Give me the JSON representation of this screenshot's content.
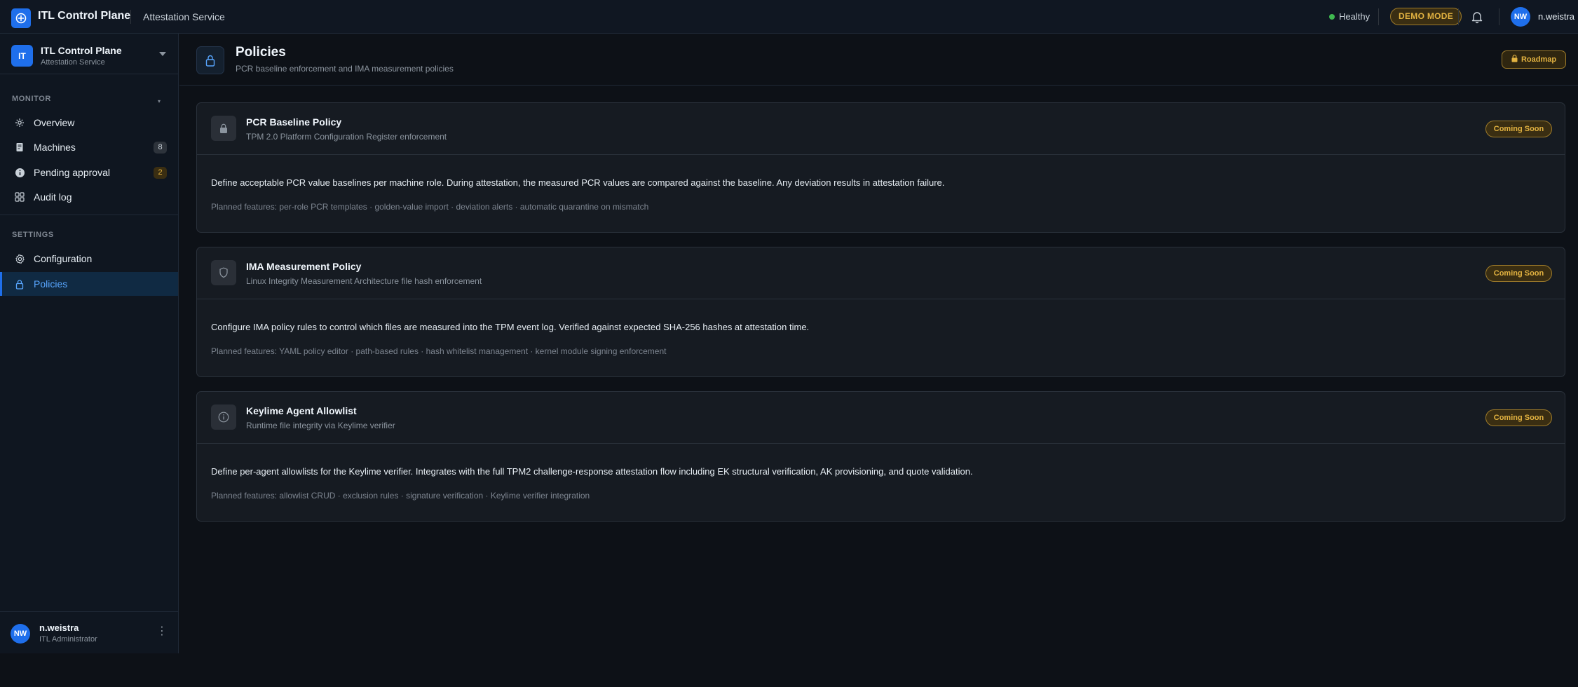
{
  "topbar": {
    "app_name": "ITL Control Plane",
    "service_name": "Attestation Service",
    "health_label": "Healthy",
    "demo_label": "DEMO MODE",
    "user_initials": "NW",
    "user_name": "n.weistra"
  },
  "sidebar": {
    "org_initials": "IT",
    "org_name": "ITL Control Plane",
    "org_sub": "Attestation Service",
    "monitor_label": "MONITOR",
    "settings_label": "SETTINGS",
    "items": [
      {
        "label": "Overview",
        "icon": "overview-icon"
      },
      {
        "label": "Machines",
        "icon": "document-icon",
        "count": "8"
      },
      {
        "label": "Pending approval",
        "icon": "info-icon",
        "count": "2"
      },
      {
        "label": "Audit log",
        "icon": "grid-icon"
      },
      {
        "label": "Configuration",
        "icon": "gear-icon"
      },
      {
        "label": "Policies",
        "icon": "lock-icon",
        "active": true
      }
    ],
    "user": {
      "initials": "NW",
      "name": "n.weistra",
      "role": "ITL Administrator"
    }
  },
  "page": {
    "title": "Policies",
    "subtitle": "PCR baseline enforcement and IMA measurement policies",
    "roadmap_label": "Roadmap"
  },
  "cards": [
    {
      "icon": "lock-icon",
      "title": "PCR Baseline Policy",
      "subtitle": "TPM 2.0 Platform Configuration Register enforcement",
      "badge": "Coming Soon",
      "description": "Define acceptable PCR value baselines per machine role. During attestation, the measured PCR values are compared against the baseline. Any deviation results in attestation failure.",
      "features": "Planned features: per-role PCR templates · golden-value import · deviation alerts · automatic quarantine on mismatch"
    },
    {
      "icon": "shield-icon",
      "title": "IMA Measurement Policy",
      "subtitle": "Linux Integrity Measurement Architecture file hash enforcement",
      "badge": "Coming Soon",
      "description": "Configure IMA policy rules to control which files are measured into the TPM event log. Verified against expected SHA-256 hashes at attestation time.",
      "features": "Planned features: YAML policy editor · path-based rules · hash whitelist management · kernel module signing enforcement"
    },
    {
      "icon": "info-icon",
      "title": "Keylime Agent Allowlist",
      "subtitle": "Runtime file integrity via Keylime verifier",
      "badge": "Coming Soon",
      "description": "Define per-agent allowlists for the Keylime verifier. Integrates with the full TPM2 challenge-response attestation flow including EK structural verification, AK provisioning, and quote validation.",
      "features": "Planned features: allowlist CRUD · exclusion rules · signature verification · Keylime verifier integration"
    }
  ],
  "colors": {
    "accent": "#1f6feb",
    "warning": "#e3b341",
    "healthy": "#3fb950",
    "background": "#0d1117"
  }
}
